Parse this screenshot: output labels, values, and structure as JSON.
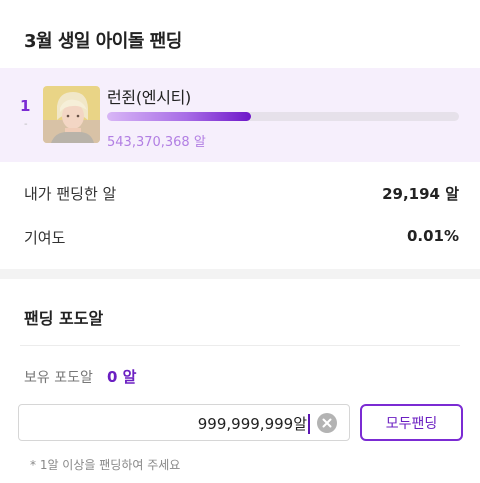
{
  "header": {
    "title": "3월 생일 아이돌 팬딩"
  },
  "ranking": {
    "rank": "1",
    "rank_change": "-",
    "idol_name": "런쥔(엔시티)",
    "egg_total": "543,370,368 알",
    "progress_fraction": 0.41,
    "avatar_icon": "idol-portrait"
  },
  "stats": {
    "my_label": "내가 팬딩한 알",
    "my_value": "29,194 알",
    "contribution_label": "기여도",
    "contribution_value": "0.01%"
  },
  "fanding": {
    "section_title": "팬딩 포도알",
    "holding_label": "보유 포도알",
    "holding_value": "0 알",
    "amount_value": "999,999,999알",
    "clear_icon": "clear-x-circle-icon",
    "all_button_label": "모두팬딩",
    "note": "* 1알 이상을 팬딩하여 주세요"
  },
  "colors": {
    "accent": "#7b2bd3",
    "card_bg": "#f6effc",
    "egg_text": "#b27fe3"
  }
}
